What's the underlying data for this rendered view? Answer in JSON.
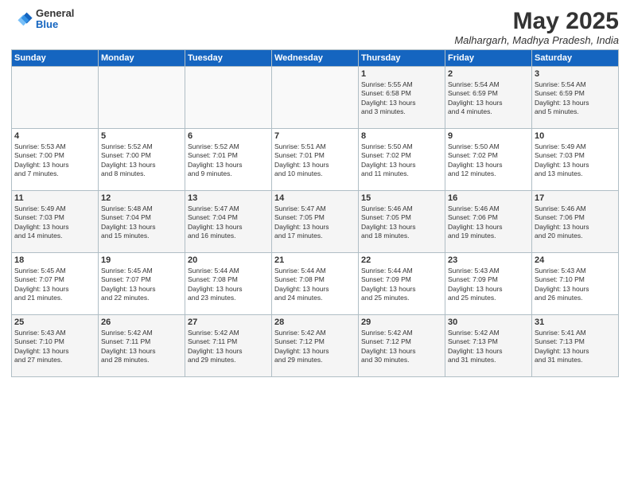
{
  "header": {
    "logo_general": "General",
    "logo_blue": "Blue",
    "month_title": "May 2025",
    "location": "Malhargarh, Madhya Pradesh, India"
  },
  "days_of_week": [
    "Sunday",
    "Monday",
    "Tuesday",
    "Wednesday",
    "Thursday",
    "Friday",
    "Saturday"
  ],
  "weeks": [
    [
      {
        "day": "",
        "info": ""
      },
      {
        "day": "",
        "info": ""
      },
      {
        "day": "",
        "info": ""
      },
      {
        "day": "",
        "info": ""
      },
      {
        "day": "1",
        "info": "Sunrise: 5:55 AM\nSunset: 6:58 PM\nDaylight: 13 hours\nand 3 minutes."
      },
      {
        "day": "2",
        "info": "Sunrise: 5:54 AM\nSunset: 6:59 PM\nDaylight: 13 hours\nand 4 minutes."
      },
      {
        "day": "3",
        "info": "Sunrise: 5:54 AM\nSunset: 6:59 PM\nDaylight: 13 hours\nand 5 minutes."
      }
    ],
    [
      {
        "day": "4",
        "info": "Sunrise: 5:53 AM\nSunset: 7:00 PM\nDaylight: 13 hours\nand 7 minutes."
      },
      {
        "day": "5",
        "info": "Sunrise: 5:52 AM\nSunset: 7:00 PM\nDaylight: 13 hours\nand 8 minutes."
      },
      {
        "day": "6",
        "info": "Sunrise: 5:52 AM\nSunset: 7:01 PM\nDaylight: 13 hours\nand 9 minutes."
      },
      {
        "day": "7",
        "info": "Sunrise: 5:51 AM\nSunset: 7:01 PM\nDaylight: 13 hours\nand 10 minutes."
      },
      {
        "day": "8",
        "info": "Sunrise: 5:50 AM\nSunset: 7:02 PM\nDaylight: 13 hours\nand 11 minutes."
      },
      {
        "day": "9",
        "info": "Sunrise: 5:50 AM\nSunset: 7:02 PM\nDaylight: 13 hours\nand 12 minutes."
      },
      {
        "day": "10",
        "info": "Sunrise: 5:49 AM\nSunset: 7:03 PM\nDaylight: 13 hours\nand 13 minutes."
      }
    ],
    [
      {
        "day": "11",
        "info": "Sunrise: 5:49 AM\nSunset: 7:03 PM\nDaylight: 13 hours\nand 14 minutes."
      },
      {
        "day": "12",
        "info": "Sunrise: 5:48 AM\nSunset: 7:04 PM\nDaylight: 13 hours\nand 15 minutes."
      },
      {
        "day": "13",
        "info": "Sunrise: 5:47 AM\nSunset: 7:04 PM\nDaylight: 13 hours\nand 16 minutes."
      },
      {
        "day": "14",
        "info": "Sunrise: 5:47 AM\nSunset: 7:05 PM\nDaylight: 13 hours\nand 17 minutes."
      },
      {
        "day": "15",
        "info": "Sunrise: 5:46 AM\nSunset: 7:05 PM\nDaylight: 13 hours\nand 18 minutes."
      },
      {
        "day": "16",
        "info": "Sunrise: 5:46 AM\nSunset: 7:06 PM\nDaylight: 13 hours\nand 19 minutes."
      },
      {
        "day": "17",
        "info": "Sunrise: 5:46 AM\nSunset: 7:06 PM\nDaylight: 13 hours\nand 20 minutes."
      }
    ],
    [
      {
        "day": "18",
        "info": "Sunrise: 5:45 AM\nSunset: 7:07 PM\nDaylight: 13 hours\nand 21 minutes."
      },
      {
        "day": "19",
        "info": "Sunrise: 5:45 AM\nSunset: 7:07 PM\nDaylight: 13 hours\nand 22 minutes."
      },
      {
        "day": "20",
        "info": "Sunrise: 5:44 AM\nSunset: 7:08 PM\nDaylight: 13 hours\nand 23 minutes."
      },
      {
        "day": "21",
        "info": "Sunrise: 5:44 AM\nSunset: 7:08 PM\nDaylight: 13 hours\nand 24 minutes."
      },
      {
        "day": "22",
        "info": "Sunrise: 5:44 AM\nSunset: 7:09 PM\nDaylight: 13 hours\nand 25 minutes."
      },
      {
        "day": "23",
        "info": "Sunrise: 5:43 AM\nSunset: 7:09 PM\nDaylight: 13 hours\nand 25 minutes."
      },
      {
        "day": "24",
        "info": "Sunrise: 5:43 AM\nSunset: 7:10 PM\nDaylight: 13 hours\nand 26 minutes."
      }
    ],
    [
      {
        "day": "25",
        "info": "Sunrise: 5:43 AM\nSunset: 7:10 PM\nDaylight: 13 hours\nand 27 minutes."
      },
      {
        "day": "26",
        "info": "Sunrise: 5:42 AM\nSunset: 7:11 PM\nDaylight: 13 hours\nand 28 minutes."
      },
      {
        "day": "27",
        "info": "Sunrise: 5:42 AM\nSunset: 7:11 PM\nDaylight: 13 hours\nand 29 minutes."
      },
      {
        "day": "28",
        "info": "Sunrise: 5:42 AM\nSunset: 7:12 PM\nDaylight: 13 hours\nand 29 minutes."
      },
      {
        "day": "29",
        "info": "Sunrise: 5:42 AM\nSunset: 7:12 PM\nDaylight: 13 hours\nand 30 minutes."
      },
      {
        "day": "30",
        "info": "Sunrise: 5:42 AM\nSunset: 7:13 PM\nDaylight: 13 hours\nand 31 minutes."
      },
      {
        "day": "31",
        "info": "Sunrise: 5:41 AM\nSunset: 7:13 PM\nDaylight: 13 hours\nand 31 minutes."
      }
    ]
  ]
}
